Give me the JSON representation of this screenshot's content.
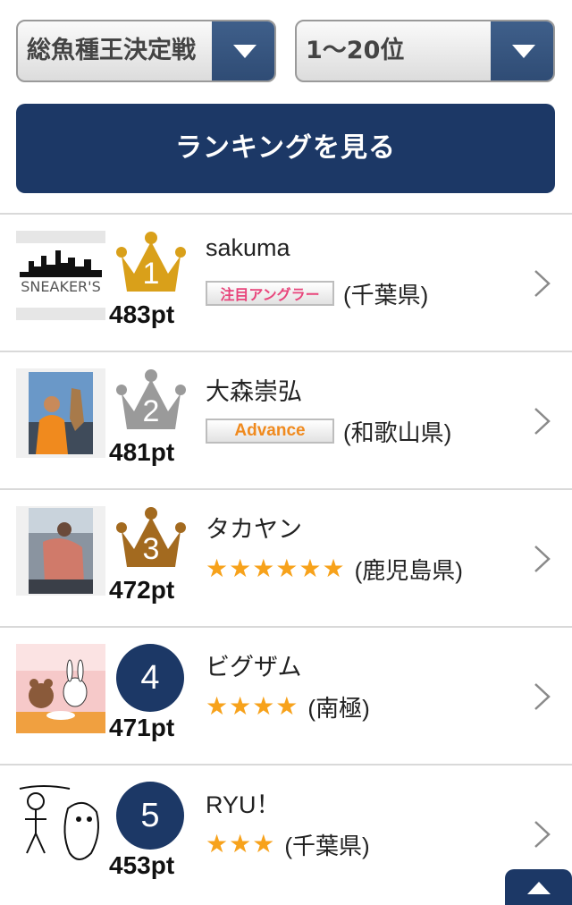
{
  "filters": {
    "category": "総魚種王決定戦",
    "range": "1〜20位",
    "view_button": "ランキングを見る"
  },
  "colors": {
    "navy": "#1c3866",
    "gold": "#d9a01a",
    "silver": "#9a9a9a",
    "bronze": "#a36a1f",
    "star": "#f7a21b"
  },
  "ranking": [
    {
      "rank": "1",
      "name": "sakuma",
      "badge": "注目アングラー",
      "stars": "",
      "pref": "(千葉県)",
      "points": "483pt",
      "crown": "gold"
    },
    {
      "rank": "2",
      "name": "大森崇弘",
      "badge": "Advance",
      "stars": "",
      "pref": "(和歌山県)",
      "points": "481pt",
      "crown": "silver"
    },
    {
      "rank": "3",
      "name": "タカヤン",
      "badge": "",
      "stars": "★★★★★★",
      "pref": "(鹿児島県)",
      "points": "472pt",
      "crown": "bronze"
    },
    {
      "rank": "4",
      "name": "ビグザム",
      "badge": "",
      "stars": "★★★★",
      "pref": "(南極)",
      "points": "471pt",
      "crown": ""
    },
    {
      "rank": "5",
      "name": "RYU！",
      "badge": "",
      "stars": "★★★",
      "pref": "(千葉県)",
      "points": "453pt",
      "crown": ""
    }
  ],
  "icons": {
    "chevron": "chevron-right-icon",
    "back_to_top": "chevron-up-icon"
  }
}
